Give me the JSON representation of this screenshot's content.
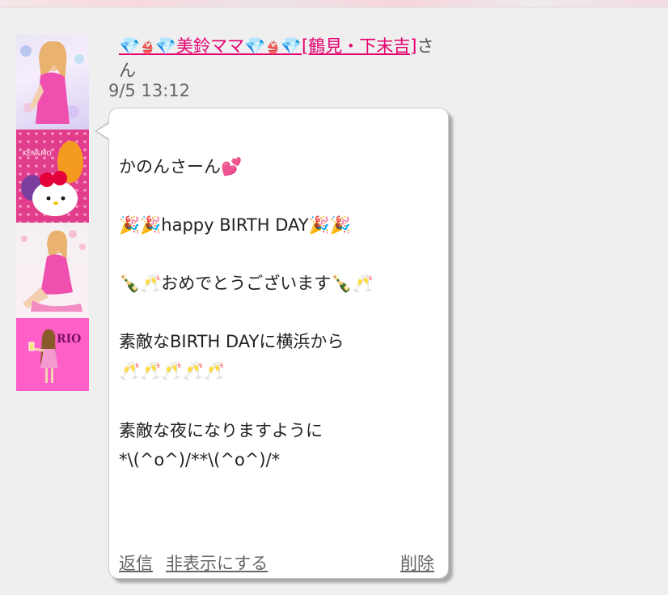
{
  "post": {
    "poster_gem1": "💎",
    "poster_bra1": "👙",
    "poster_gem2": "💎",
    "poster_name_main": "美鈴ママ",
    "poster_gem3": "💎",
    "poster_bra2": "👙",
    "poster_gem4": "💎",
    "poster_location": "[鶴見・下末吉]",
    "poster_suffix": "さん",
    "timestamp": "9/5 13:12"
  },
  "message": {
    "line1": "かのんさーん💕",
    "line2": "🎉🎉happy BIRTH DAY🎉🎉",
    "line3": "🍾🥂おめでとうございます🍾🥂",
    "line4": "素敵なBIRTH DAYに横浜から",
    "line5": "🥂🥂🥂🥂🥂",
    "line6": "素敵な夜になりますように",
    "line7": "*\\(^o^)/**\\(^o^)/*"
  },
  "actions": {
    "reply": "返信",
    "hide": "非表示にする",
    "delete": "削除"
  },
  "colors": {
    "link_pink": "#e4006e",
    "background": "#efefef"
  }
}
